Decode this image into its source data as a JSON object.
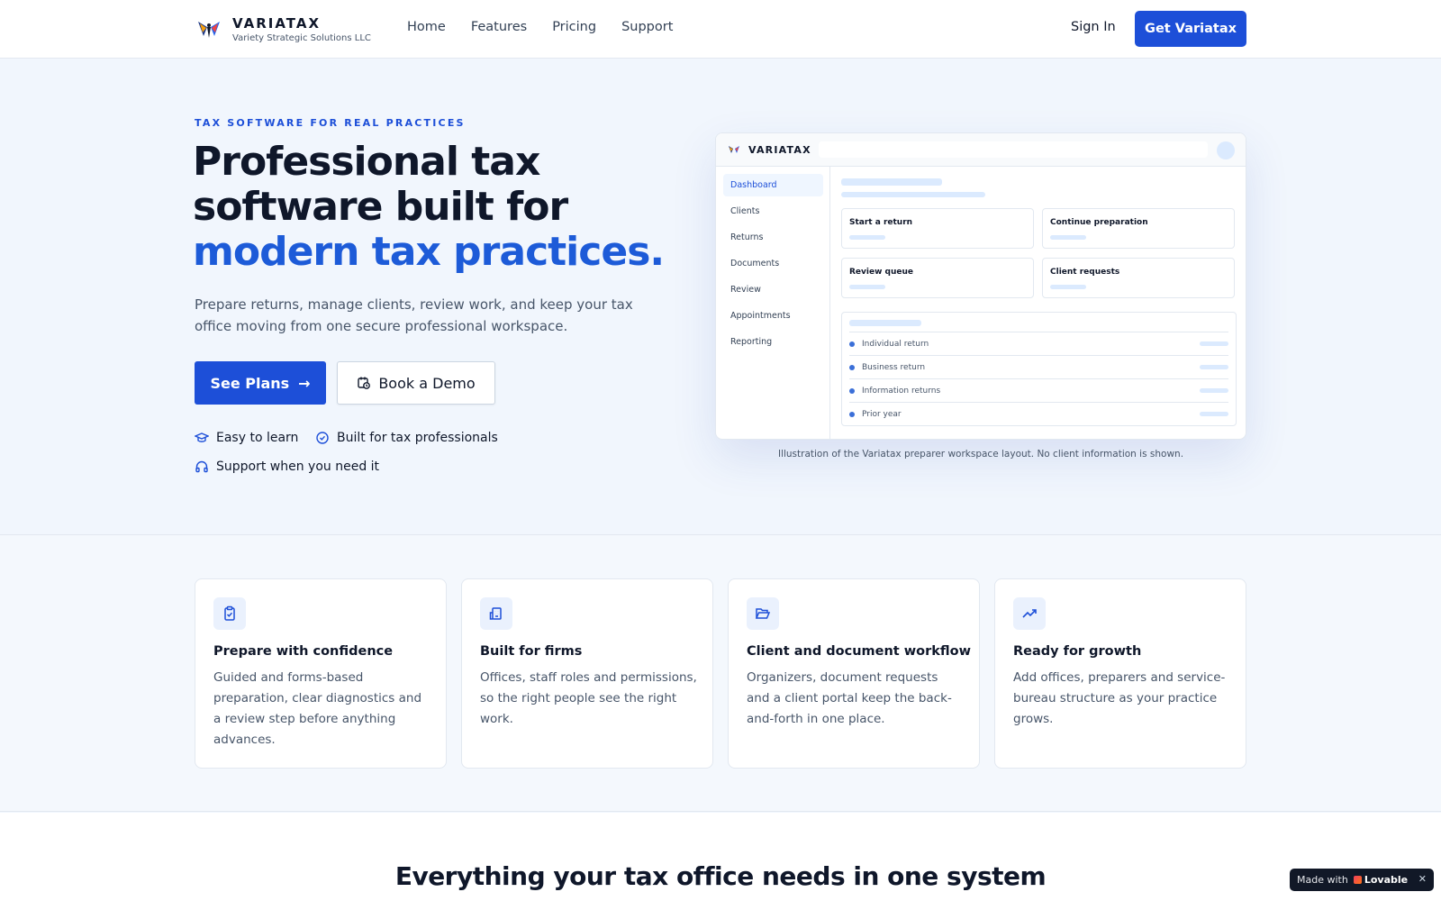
{
  "header": {
    "brand_name": "VARIATAX",
    "brand_sub": "Variety Strategic Solutions LLC",
    "nav": [
      "Home",
      "Features",
      "Pricing",
      "Support"
    ],
    "sign_in": "Sign In",
    "cta": "Get Variatax"
  },
  "hero": {
    "eyebrow": "TAX SOFTWARE FOR REAL PRACTICES",
    "title_part1": "Professional tax software built for ",
    "title_accent": "modern tax practices.",
    "lead": "Prepare returns, manage clients, review work, and keep your tax office moving from one secure professional workspace.",
    "primary_button": "See Plans",
    "secondary_button": "Book a Demo",
    "features": [
      "Easy to learn",
      "Built for tax professionals",
      "Support when you need it"
    ]
  },
  "mockup": {
    "brand": "VARIATAX",
    "sidebar": [
      "Dashboard",
      "Clients",
      "Returns",
      "Documents",
      "Review",
      "Appointments",
      "Reporting"
    ],
    "cards": [
      "Start a return",
      "Continue preparation",
      "Review queue",
      "Client requests"
    ],
    "list": [
      "Individual return",
      "Business return",
      "Information returns",
      "Prior year"
    ],
    "caption": "Illustration of the Variatax preparer workspace layout. No client information is shown."
  },
  "features": [
    {
      "icon": "clipboard-check-icon",
      "title": "Prepare with confidence",
      "desc": "Guided and forms-based preparation, clear diagnostics and a review step before anything advances."
    },
    {
      "icon": "building-icon",
      "title": "Built for firms",
      "desc": "Offices, staff roles and permissions, so the right people see the right work."
    },
    {
      "icon": "folder-open-icon",
      "title": "Client and document workflow",
      "desc": "Organizers, document requests and a client portal keep the back-and-forth in one place."
    },
    {
      "icon": "trending-up-icon",
      "title": "Ready for growth",
      "desc": "Add offices, preparers and service-bureau structure as your practice grows."
    }
  ],
  "section3": {
    "title": "Everything your tax office needs in one system"
  },
  "badge": {
    "made_with": "Made with",
    "brand": "Lovable",
    "close": "✕"
  },
  "colors": {
    "accent": "#1d4fd8",
    "background": "#f1f6fd"
  }
}
